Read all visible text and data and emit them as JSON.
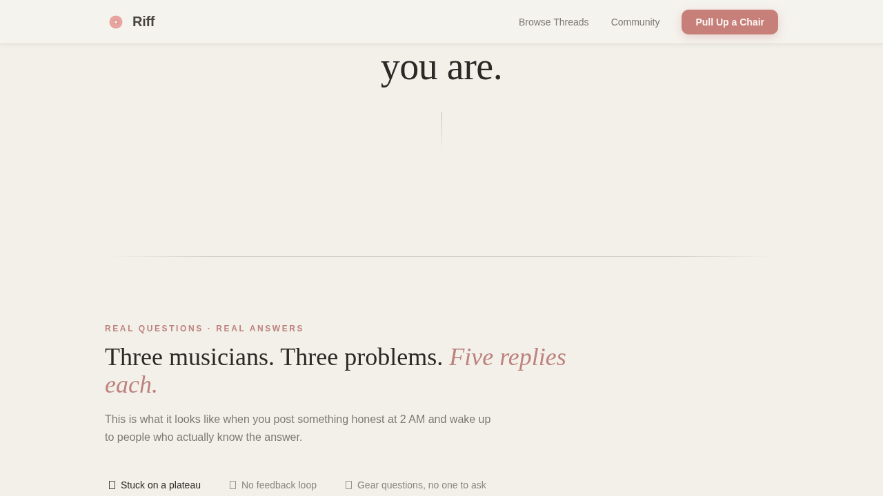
{
  "nav": {
    "brand": "Riff",
    "links": [
      "Browse Threads",
      "Community"
    ],
    "cta": "Pull Up a Chair"
  },
  "hero": {
    "heading_end": "you are."
  },
  "section": {
    "eyebrow": "REAL QUESTIONS · REAL ANSWERS",
    "heading": "Three musicians. Three problems. *Five replies each.*",
    "intro": "This is what it looks like when you post something honest at 2 AM and wake up to people who actually know the answer.",
    "tabs": [
      {
        "label": "Stuck on a plateau",
        "selected": true
      },
      {
        "label": "No feedback loop",
        "selected": false
      },
      {
        "label": "Gear questions, no one to ask",
        "selected": false
      }
    ]
  }
}
